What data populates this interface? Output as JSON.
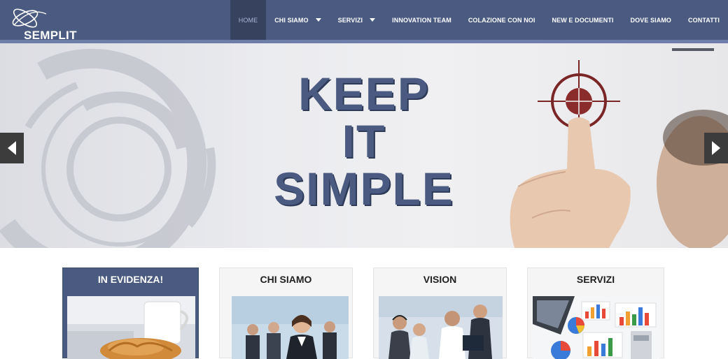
{
  "header": {
    "logo_text": "SEMPLIT",
    "nav": [
      {
        "label": "HOME",
        "active": true,
        "dropdown": false
      },
      {
        "label": "CHI SIAMO",
        "active": false,
        "dropdown": true
      },
      {
        "label": "SERVIZI",
        "active": false,
        "dropdown": true
      },
      {
        "label": "INNOVATION TEAM",
        "active": false,
        "dropdown": false
      },
      {
        "label": "COLAZIONE CON NOI",
        "active": false,
        "dropdown": false
      },
      {
        "label": "NEW E DOCUMENTI",
        "active": false,
        "dropdown": false
      },
      {
        "label": "DOVE SIAMO",
        "active": false,
        "dropdown": false
      },
      {
        "label": "CONTATTI",
        "active": false,
        "dropdown": false
      }
    ]
  },
  "hero": {
    "line1": "KEEP",
    "line2": "IT",
    "line3": "SIMPLE"
  },
  "cards": [
    {
      "title": "IN EVIDENZA!",
      "image": "croissant-coffee-photo"
    },
    {
      "title": "CHI SIAMO",
      "image": "business-team-photo"
    },
    {
      "title": "VISION",
      "image": "call-center-photo"
    },
    {
      "title": "SERVIZI",
      "image": "charts-laptop-photo"
    }
  ],
  "colors": {
    "brand": "#4a5a80",
    "brand_dark": "#36425e",
    "target_red": "#8b2c2c"
  }
}
